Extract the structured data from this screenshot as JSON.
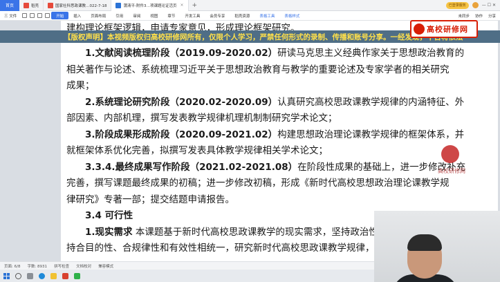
{
  "tabs": {
    "home": "首页",
    "items": [
      {
        "label": "稻壳",
        "color": "#e64a3b",
        "active": false
      },
      {
        "label": "国家社科思政课教…022-7-18",
        "color": "#e64a3b",
        "active": false
      },
      {
        "label": "蒲清平-附件3…项课题论证活页",
        "color": "#2b73d6",
        "active": true
      }
    ],
    "add": "+"
  },
  "titlebar": {
    "login_badge": "已登录服务",
    "window_controls": "— ☐ ✕"
  },
  "ribbon": {
    "file_menu": "三 文件",
    "tabs": [
      {
        "label": "开始",
        "active": true,
        "highlight": false
      },
      {
        "label": "插入",
        "active": false,
        "highlight": false
      },
      {
        "label": "页面布局",
        "active": false,
        "highlight": false
      },
      {
        "label": "引用",
        "active": false,
        "highlight": false
      },
      {
        "label": "审阅",
        "active": false,
        "highlight": false
      },
      {
        "label": "视图",
        "active": false,
        "highlight": false
      },
      {
        "label": "章节",
        "active": false,
        "highlight": false
      },
      {
        "label": "开发工具",
        "active": false,
        "highlight": false
      },
      {
        "label": "会员专享",
        "active": false,
        "highlight": false
      },
      {
        "label": "稻壳资源",
        "active": false,
        "highlight": false
      },
      {
        "label": "表格工具",
        "active": false,
        "highlight": true
      },
      {
        "label": "表格样式",
        "active": false,
        "highlight": true
      }
    ],
    "unsaved": "未同步",
    "collab": "协作",
    "share": "分享"
  },
  "banner": "【版权声明】本视频版权归高校研修网所有，仅限个人学习，严禁任何形式的录制、传播和账号分享。一经发现，平台将依法",
  "logo_text": "高校研修网",
  "watermark_text": "高校研修网",
  "document": {
    "top_line": "建构理论框架逻辑，申请专家意见，形成理论框架研究。",
    "p1": {
      "num": "1.",
      "head": "文献阅读梳理阶段",
      "date": "（2019.09-2020.02）",
      "line1": "研读马克思主义经典作家关于思想政治教育的",
      "line2": "相关著作与论述、系统梳理习近平关于思想政治教育与教学的重要论述及专家学者的相关研究",
      "line3": "成果；"
    },
    "p2": {
      "num": "2.",
      "head": "系统理论研究阶段",
      "date": "（2020.02-2020.09）",
      "line1": "认真研究高校思政课教学规律的内涵特征、外",
      "line2": "部因素、内部机理，撰写发表教学规律机理机制制研究学术论文；"
    },
    "p3": {
      "num": "3.",
      "head": "阶段成果形成阶段",
      "date": "（2020.09-2021.02）",
      "line1": "构建思想政治理论课教学规律的框架体系，并",
      "line2": "就框架体系优化完善，拟撰写发表具体教学规律相关学术论文；"
    },
    "p4": {
      "num": "3.3.4.",
      "head": "最终成果写作阶段",
      "date": "（2021.02-2021.08）",
      "line1": "在阶段性成果的基础上，进一步修改补充",
      "line2": "完善，撰写课题最终成果的初稿；进一步修改初稿，形成《新时代高校思想政治理论课教学规",
      "line3": "律研究》专著一部；提交结题申请报告。"
    },
    "sec_heading": "3.4  可行性",
    "p5": {
      "num": "1.",
      "head": "现实需求",
      "line1": "本课题基于新时代高校思政课教学的现实需求，坚持政治性和",
      "line2": "持合目的性、合规律性和有效性相统一，研究新时代高校思政课教学规律，有"
    }
  },
  "statusbar": {
    "page": "页面: 6/8",
    "words": "字数: 8931",
    "spell": "拼写检查",
    "proof": "文档校对",
    "compat": "兼容模式"
  }
}
